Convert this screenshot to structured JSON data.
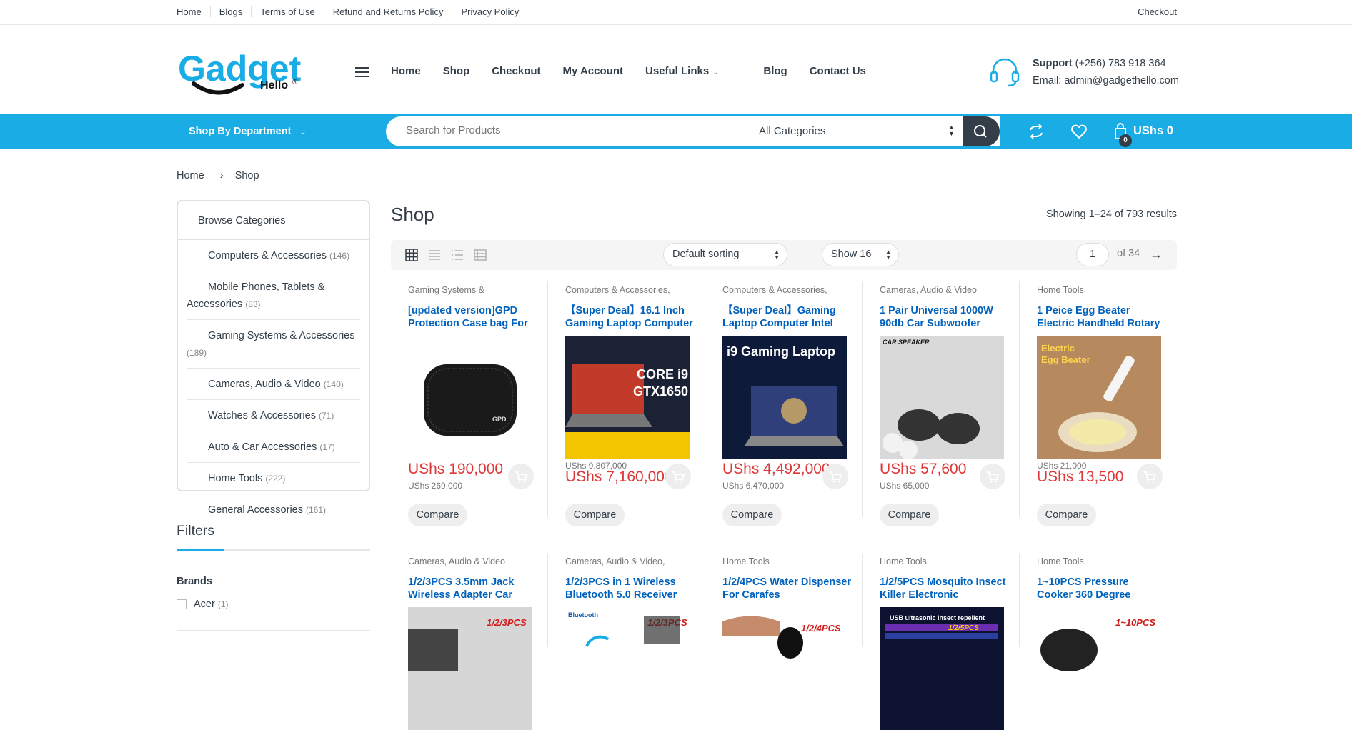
{
  "topbar": {
    "links": [
      "Home",
      "Blogs",
      "Terms of Use",
      "Refund and Returns Policy",
      "Privacy Policy"
    ],
    "right": "Checkout"
  },
  "logo": {
    "main": "Gadget",
    "sub": "Hello",
    "mark": "®"
  },
  "nav": {
    "items": [
      "Home",
      "Shop",
      "Checkout",
      "My Account",
      "Useful Links",
      "Blog",
      "Contact Us"
    ]
  },
  "support": {
    "label": "Support",
    "phone": "(+256) 783 918 364",
    "email": "Email: admin@gadgethello.com"
  },
  "bluebar": {
    "department": "Shop By Department",
    "search_placeholder": "Search for Products",
    "category": "All Categories",
    "cart_total": "USh​s 0",
    "cart_count": "0"
  },
  "breadcrumb": [
    "Home",
    "Shop"
  ],
  "sidebar": {
    "title": "Browse Categories",
    "categories": [
      {
        "name": "Computers & Accessories",
        "count": "(146)"
      },
      {
        "name": "Mobile Phones, Tablets & Accessories",
        "count": "(83)"
      },
      {
        "name": "Gaming Systems & Accessories",
        "count": "(189)"
      },
      {
        "name": "Cameras, Audio & Video",
        "count": "(140)"
      },
      {
        "name": "Watches & Accessories",
        "count": "(71)"
      },
      {
        "name": "Auto & Car Accessories",
        "count": "(17)"
      },
      {
        "name": "Home Tools",
        "count": "(222)"
      },
      {
        "name": "General Accessories",
        "count": "(161)"
      }
    ],
    "filters_title": "Filters",
    "brands_title": "Brands",
    "brands": [
      {
        "name": "Acer",
        "count": "(1)"
      }
    ]
  },
  "main": {
    "title": "Shop",
    "results": "Showing 1–24 of 793 results",
    "sorting": "Default sorting",
    "show": "Show 16",
    "page": "1",
    "of_pages": "of 34"
  },
  "products": [
    {
      "category": "Gaming Systems &",
      "name": "[updated version]GPD Protection Case bag For",
      "price": "USh​s 190,000",
      "old_price": "USh​s 269,000",
      "compare": "Compare"
    },
    {
      "category": "Computers & Accessories,",
      "name": "【Super Deal】16.1 Inch Gaming Laptop Computer",
      "price": "USh​s 7,160,000",
      "old_price": "USh​s 9,807,000",
      "compare": "Compare"
    },
    {
      "category": "Computers & Accessories,",
      "name": "【Super Deal】Gaming Laptop Computer Intel",
      "price": "USh​s 4,492,000",
      "old_price": "USh​s 6,470,000",
      "compare": "Compare"
    },
    {
      "category": "Cameras, Audio & Video",
      "name": "1 Pair Universal 1000W 90db Car Subwoofer",
      "price": "USh​s 57,600",
      "old_price": "USh​s 65,000",
      "compare": "Compare"
    },
    {
      "category": "Home Tools",
      "name": "1 Peice Egg Beater Electric Handheld Rotary",
      "price": "USh​s 13,500",
      "old_price": "USh​s 21,000",
      "compare": "Compare"
    },
    {
      "category": "Cameras, Audio & Video",
      "name": "1/2/3PCS 3.5mm Jack Wireless Adapter Car"
    },
    {
      "category": "Cameras, Audio & Video,",
      "name": "1/2/3PCS in 1 Wireless Bluetooth 5.0 Receiver"
    },
    {
      "category": "Home Tools",
      "name": "1/2/4PCS Water Dispenser For Carafes"
    },
    {
      "category": "Home Tools",
      "name": "1/2/5PCS Mosquito Insect Killer Electronic"
    },
    {
      "category": "Home Tools",
      "name": "1~10PCS Pressure Cooker 360 Degree"
    }
  ],
  "image_text": {
    "p2_line1": "CORE i9",
    "p2_line2": "GTX1650",
    "p3_title": "i9 Gaming Laptop",
    "p4_label": "CAR SPEAKER",
    "p5_line1": "Electric",
    "p5_line2": "Egg Beater",
    "r2_p1": "1/2/3PCS",
    "r2_p2_brand": "Bluetooth",
    "r2_p2": "1/2/3PCS",
    "r2_p3": "1/2/4PCS",
    "r2_p4": "USB ultrasonic insect repellent",
    "r2_p4b": "1/2/5PCS",
    "r2_p5": "1~10PCS"
  },
  "colors": {
    "accent": "#1aace4",
    "dark": "#333e48",
    "price": "#df3737",
    "link": "#0062bd"
  }
}
